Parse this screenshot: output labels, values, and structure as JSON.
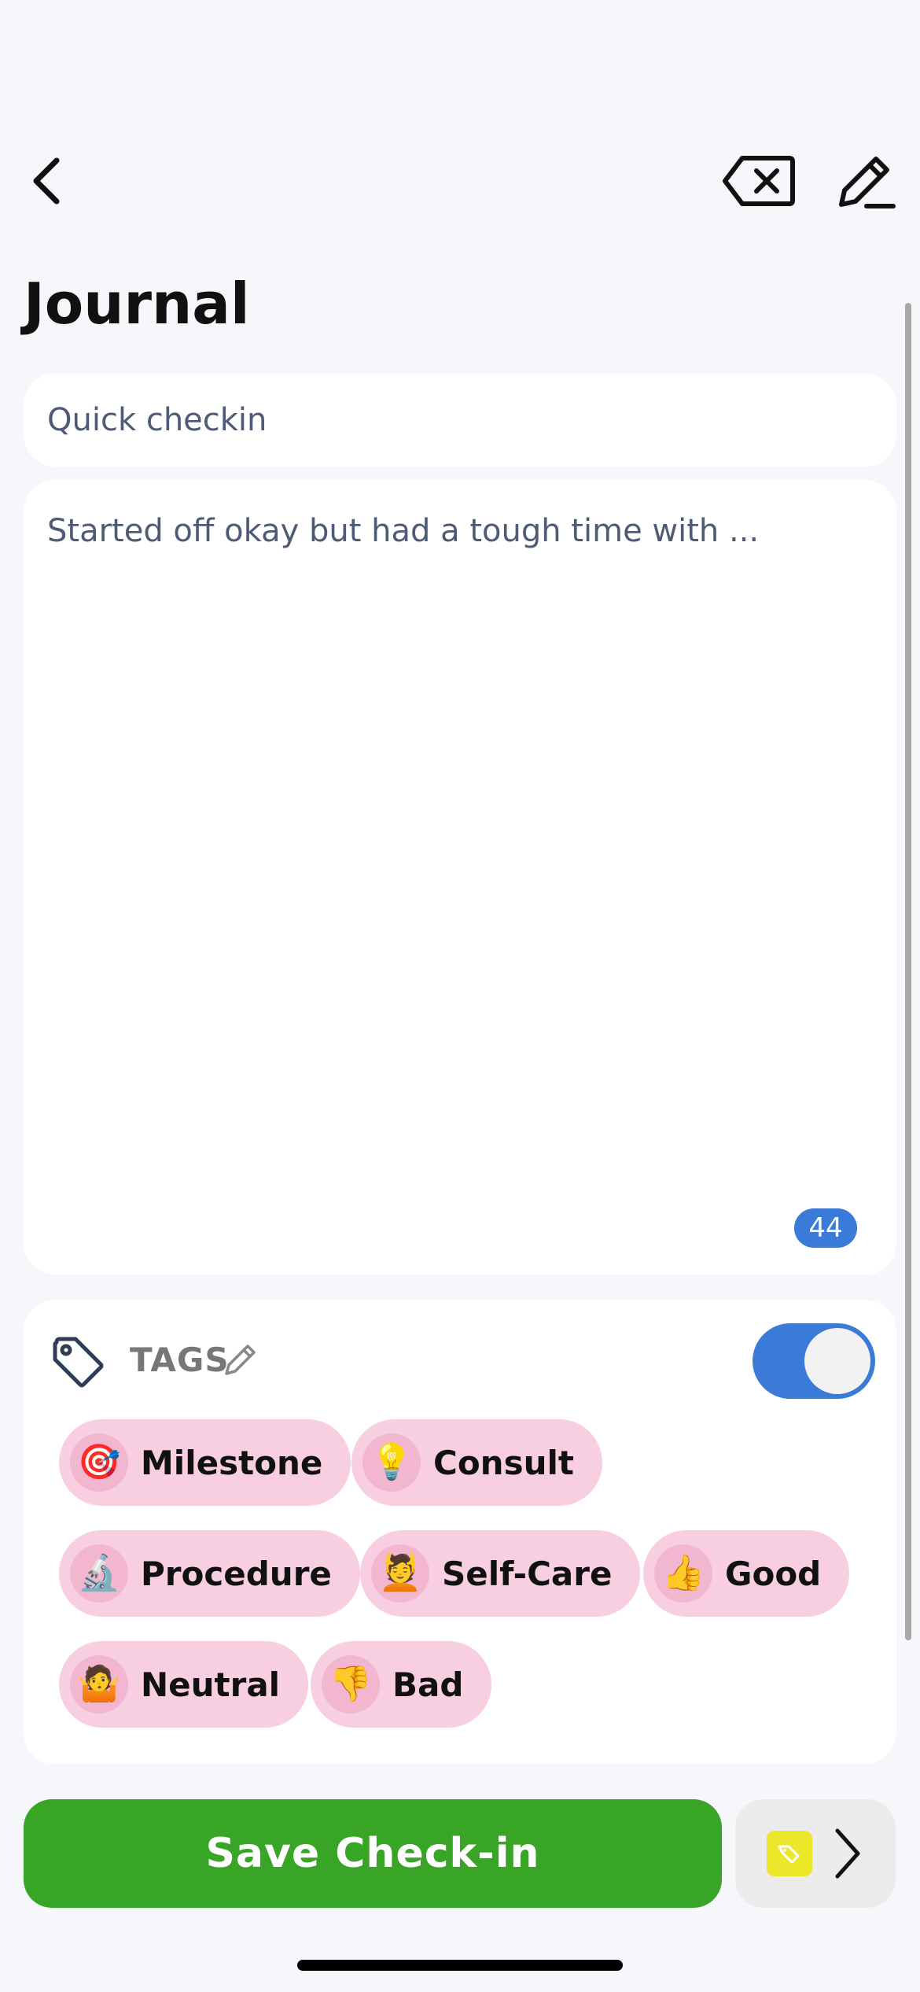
{
  "header": {
    "back_icon": "chevron-left-icon",
    "clear_icon": "backspace-x-icon",
    "edit_icon": "pencil-icon"
  },
  "page": {
    "title": "Journal"
  },
  "entry": {
    "title_value": "Quick checkin",
    "body_value": "Started off okay but had a tough time with ...",
    "char_count": "44"
  },
  "tags": {
    "label": "TAGS",
    "toggle_on": true,
    "items": [
      {
        "emoji": "🎯",
        "label": "Milestone"
      },
      {
        "emoji": "💡",
        "label": "Consult"
      },
      {
        "emoji": "🔬",
        "label": "Procedure"
      },
      {
        "emoji": "💆",
        "label": "Self-Care"
      },
      {
        "emoji": "👍",
        "label": "Good"
      },
      {
        "emoji": "🤷",
        "label": "Neutral"
      },
      {
        "emoji": "👎",
        "label": "Bad"
      }
    ]
  },
  "footer": {
    "save_label": "Save Check-in",
    "more_icon": "tag-icon"
  },
  "colors": {
    "accent_blue": "#3b7bd8",
    "save_green": "#39a526",
    "tag_pink": "#f8cfe0",
    "tag_yellow": "#ede72a"
  }
}
